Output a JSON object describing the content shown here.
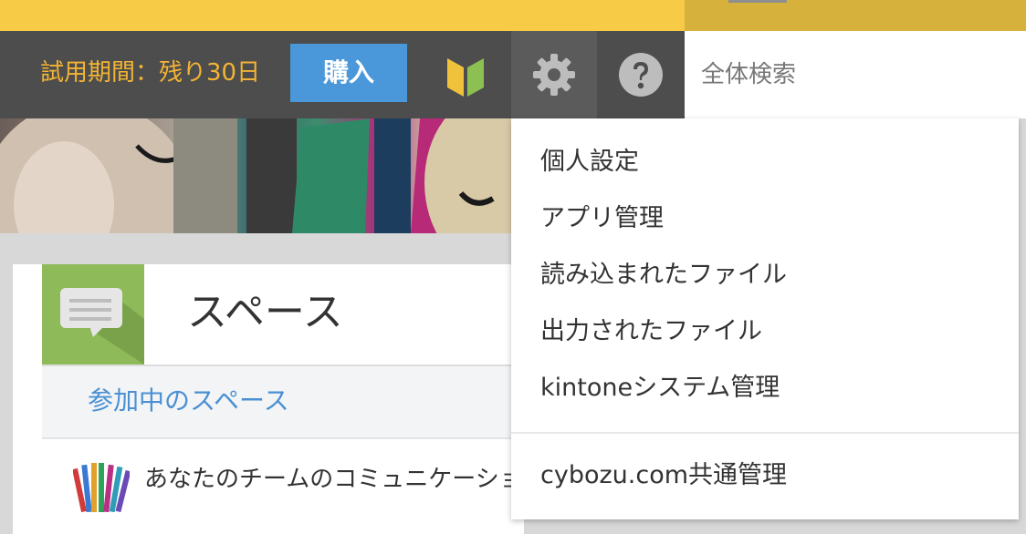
{
  "header": {
    "trial_text": "試用期間：残り30日",
    "buy_label": "購入",
    "beginner_icon": "beginner-leaf-icon",
    "settings_icon": "gear-icon",
    "help_icon": "help-icon"
  },
  "search": {
    "placeholder": "全体検索"
  },
  "space_card": {
    "title": "スペース",
    "participating_label": "参加中のスペース",
    "space_name": "あなたのチームのコミュニケーションスペース"
  },
  "settings_menu": {
    "items": [
      "個人設定",
      "アプリ管理",
      "読み込まれたファイル",
      "出力されたファイル",
      "kintoneシステム管理"
    ],
    "footer_item": "cybozu.com共通管理"
  },
  "colors": {
    "top_strip": "#f7cb45",
    "header_bg": "#4d4d4d",
    "trial_text": "#f2b434",
    "buy_button": "#4a98d9",
    "link_blue": "#4a90d2",
    "space_icon_green": "#8fba5a"
  }
}
